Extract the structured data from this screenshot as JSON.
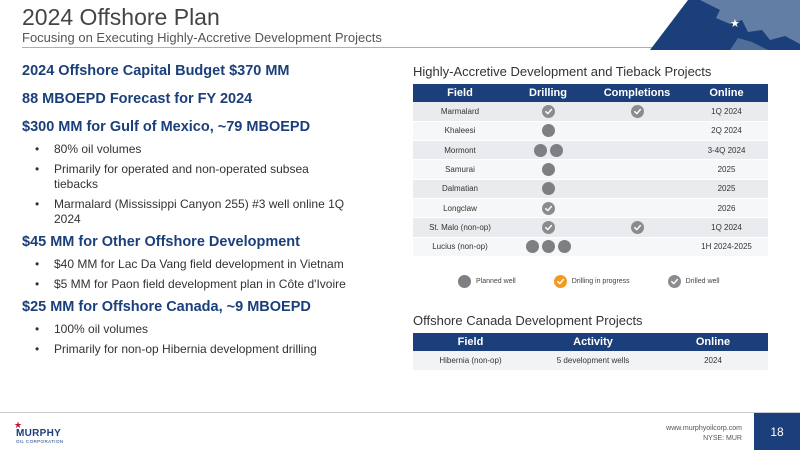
{
  "header": {
    "title": "2024 Offshore Plan",
    "subtitle": "Focusing on Executing Highly-Accretive Development Projects"
  },
  "left": {
    "budget_heading": "2024 Offshore Capital Budget $370 MM",
    "forecast_heading": "88 MBOEPD Forecast for FY 2024",
    "gom_heading": "$300 MM for Gulf of Mexico, ~79 MBOEPD",
    "gom_bullets": [
      "80% oil volumes",
      "Primarily for operated and non-operated subsea tiebacks",
      "Marmalard (Mississippi Canyon 255) #3 well online 1Q 2024"
    ],
    "other_heading": "$45 MM for Other Offshore Development",
    "other_bullets": [
      "$40 MM for Lac Da Vang field development in Vietnam",
      "$5 MM for Paon field development plan in Côte d'Ivoire"
    ],
    "canada_heading": "$25 MM for Offshore Canada, ~9 MBOEPD",
    "canada_bullets": [
      "100% oil volumes",
      "Primarily for non-op Hibernia development drilling"
    ]
  },
  "projects_table": {
    "title": "Highly-Accretive Development and Tieback Projects",
    "headers": [
      "Field",
      "Drilling",
      "Completions",
      "Online"
    ],
    "rows": [
      {
        "field": "Marmalard",
        "drilling": [
          "drilled"
        ],
        "completions": [
          "drilled"
        ],
        "online": "1Q 2024"
      },
      {
        "field": "Khaleesi",
        "drilling": [
          "planned"
        ],
        "completions": [],
        "online": "2Q 2024"
      },
      {
        "field": "Mormont",
        "drilling": [
          "planned",
          "planned"
        ],
        "completions": [],
        "online": "3-4Q 2024"
      },
      {
        "field": "Samurai",
        "drilling": [
          "planned"
        ],
        "completions": [],
        "online": "2025"
      },
      {
        "field": "Dalmatian",
        "drilling": [
          "planned"
        ],
        "completions": [],
        "online": "2025"
      },
      {
        "field": "Longclaw",
        "drilling": [
          "drilled"
        ],
        "completions": [],
        "online": "2026"
      },
      {
        "field": "St. Malo (non-op)",
        "drilling": [
          "drilled"
        ],
        "completions": [
          "drilled"
        ],
        "online": "1Q 2024"
      },
      {
        "field": "Lucius (non-op)",
        "drilling": [
          "planned",
          "planned",
          "planned"
        ],
        "completions": [],
        "online": "1H 2024-2025"
      }
    ]
  },
  "legend": {
    "planned": "Planned well",
    "in_progress": "Drilling in progress",
    "drilled": "Drilled well"
  },
  "canada_table": {
    "title": "Offshore Canada Development Projects",
    "headers": [
      "Field",
      "Activity",
      "Online"
    ],
    "rows": [
      {
        "field": "Hibernia (non-op)",
        "activity": "5 development wells",
        "online": "2024"
      }
    ]
  },
  "footer": {
    "logo_name": "MURPHY",
    "logo_sub": "OIL CORPORATION",
    "website": "www.murphyoilcorp.com",
    "ticker": "NYSE: MUR",
    "page_number": "18"
  },
  "colors": {
    "navy": "#1b3f7a",
    "planned_gray": "#7d7f82",
    "drilled_gray": "#8a8c8f",
    "in_progress_orange": "#f39a1e"
  }
}
